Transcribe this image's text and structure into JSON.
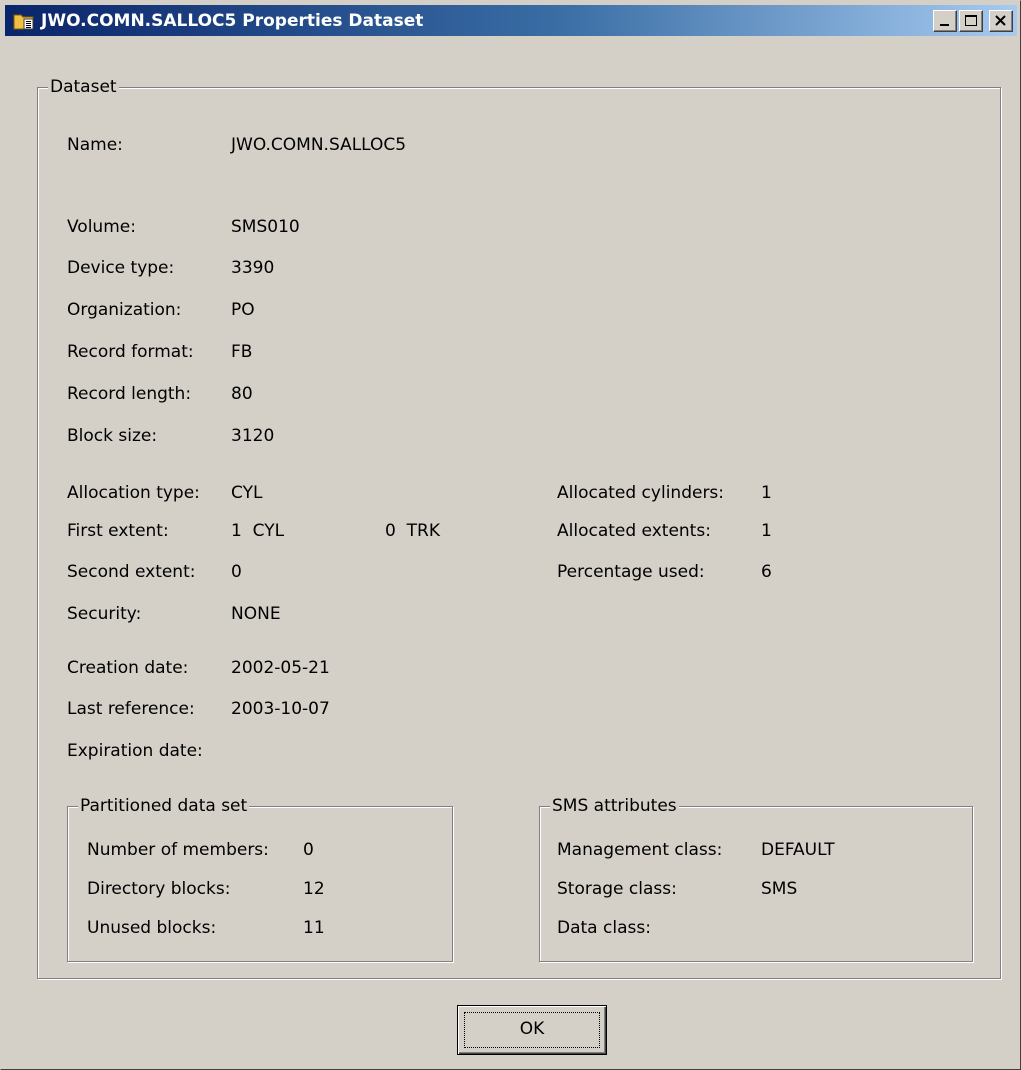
{
  "window": {
    "title": "JWO.COMN.SALLOC5 Properties Dataset",
    "title_icon": "dataset-properties-icon",
    "controls": {
      "minimize": "minimize-icon",
      "maximize": "maximize-icon",
      "close": "close-icon"
    }
  },
  "dataset": {
    "legend": "Dataset",
    "fields": {
      "name": {
        "label": "Name:",
        "value": "JWO.COMN.SALLOC5"
      },
      "volume": {
        "label": "Volume:",
        "value": "SMS010"
      },
      "device_type": {
        "label": "Device type:",
        "value": "3390"
      },
      "organization": {
        "label": "Organization:",
        "value": "PO"
      },
      "record_format": {
        "label": "Record format:",
        "value": "FB"
      },
      "record_length": {
        "label": "Record length:",
        "value": "80"
      },
      "block_size": {
        "label": "Block size:",
        "value": "3120"
      },
      "allocation_type": {
        "label": "Allocation type:",
        "value": "CYL"
      },
      "first_extent": {
        "label": "First extent:",
        "value": "1  CYL",
        "value2": "0  TRK"
      },
      "second_extent": {
        "label": "Second extent:",
        "value": "0"
      },
      "security": {
        "label": "Security:",
        "value": "NONE"
      },
      "creation_date": {
        "label": "Creation date:",
        "value": "2002-05-21"
      },
      "last_reference": {
        "label": "Last reference:",
        "value": "2003-10-07"
      },
      "expiration_date": {
        "label": "Expiration date:",
        "value": ""
      },
      "allocated_cylinders": {
        "label": "Allocated cylinders:",
        "value": "1"
      },
      "allocated_extents": {
        "label": "Allocated extents:",
        "value": "1"
      },
      "percentage_used": {
        "label": "Percentage used:",
        "value": "6"
      }
    }
  },
  "partitioned": {
    "legend": "Partitioned data set",
    "fields": {
      "number_of_members": {
        "label": "Number of members:",
        "value": "0"
      },
      "directory_blocks": {
        "label": "Directory blocks:",
        "value": "12"
      },
      "unused_blocks": {
        "label": "Unused blocks:",
        "value": "11"
      }
    }
  },
  "sms": {
    "legend": "SMS attributes",
    "fields": {
      "management_class": {
        "label": "Management class:",
        "value": "DEFAULT"
      },
      "storage_class": {
        "label": "Storage class:",
        "value": "SMS"
      },
      "data_class": {
        "label": "Data class:",
        "value": ""
      }
    }
  },
  "buttons": {
    "ok": "OK"
  },
  "colors": {
    "face": "#d4d0c8",
    "title_start": "#0a246a",
    "title_end": "#a6caf0",
    "title_text": "#ffffff"
  }
}
